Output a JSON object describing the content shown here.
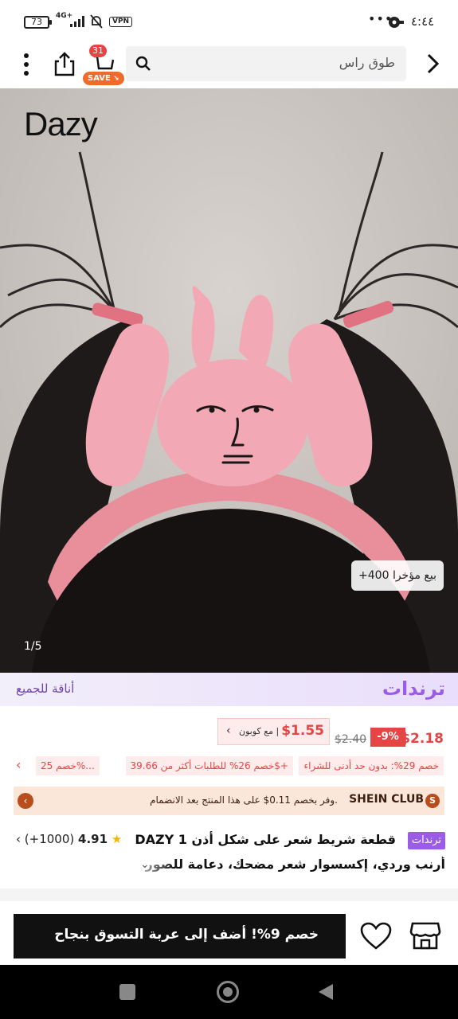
{
  "status_bar": {
    "battery": "73",
    "network": "4G+",
    "vpn": "VPN",
    "overflow": "•••",
    "time": "٤:٤٤"
  },
  "header": {
    "search_text": "طوق راس",
    "cart_count": "31",
    "save_badge": "SAVE"
  },
  "hero": {
    "brand_watermark": "Dazy",
    "sold_badge": "+400 بيع مؤخرا",
    "page_counter": "1/5"
  },
  "trends": {
    "title": "ترندات",
    "subtitle": "أناقة للجميع"
  },
  "price": {
    "current": "$2.18",
    "discount": "-9%",
    "original": "$2.40",
    "coupon_price": "$1.55",
    "coupon_label": "مع كوبون |"
  },
  "promos": [
    "خصم 29%: بدون حد أدنى للشراء",
    "خصم 26% للطلبات أكثر من 39.66$+",
    "خصم 25%..."
  ],
  "club": {
    "name": "SHEIN CLUB",
    "text": "وفر بخصم 0.11$ على هذا المنتج بعد الانضمام."
  },
  "product": {
    "trend_chip": "ترندات",
    "title_line1": "DAZY 1 قطعة شريط شعر على شكل أذن",
    "title_line2": "أرنب وردي، إكسسوار شعر مضحك، دعامة للصور",
    "rating": "4.91",
    "reviews": "(+1000)"
  },
  "bottom": {
    "add_to_cart": "خصم 9%! أضف إلى عربة التسوق بنجاح"
  },
  "colors": {
    "accent_purple": "#9b5de5",
    "price_red": "#e64545",
    "club_brown": "#b84d1e"
  }
}
